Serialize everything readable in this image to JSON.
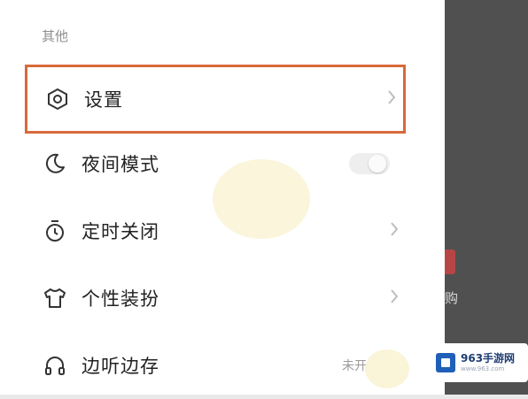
{
  "section": {
    "title": "其他"
  },
  "items": [
    {
      "label": "设置",
      "icon": "settings-hexagon-icon",
      "trailing": "chevron"
    },
    {
      "label": "夜间模式",
      "icon": "moon-icon",
      "trailing": "toggle",
      "toggle_on": false
    },
    {
      "label": "定时关闭",
      "icon": "timer-icon",
      "trailing": "chevron"
    },
    {
      "label": "个性装扮",
      "icon": "tshirt-icon",
      "trailing": "chevron"
    },
    {
      "label": "边听边存",
      "icon": "headphones-icon",
      "trailing": "status",
      "status": "未开"
    }
  ],
  "background": {
    "edge_char": "购"
  },
  "watermark": {
    "logo_text": "963手游网",
    "logo_sub": "www.963.com"
  },
  "colors": {
    "highlight": "#d66a3a",
    "accent": "#b64646"
  }
}
